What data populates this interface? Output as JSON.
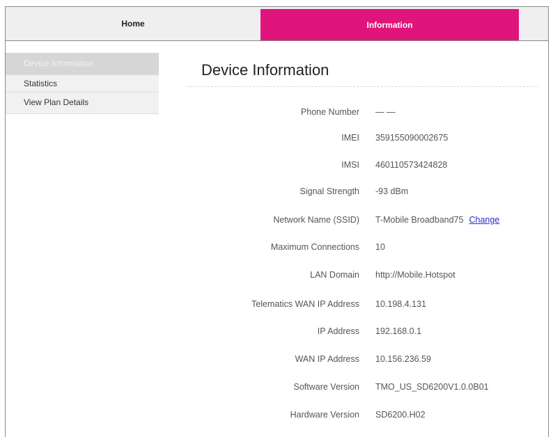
{
  "nav": {
    "home_label": "Home",
    "information_label": "Information"
  },
  "colors": {
    "accent": "#e0157b"
  },
  "sidebar": {
    "items": [
      {
        "label": "Device Information",
        "active": true
      },
      {
        "label": "Statistics",
        "active": false
      },
      {
        "label": "View Plan Details",
        "active": false
      }
    ]
  },
  "main": {
    "title": "Device Information",
    "change_link": "Change",
    "rows": [
      {
        "label": "Phone Number",
        "value": "— —"
      },
      {
        "label": "IMEI",
        "value": "359155090002675"
      },
      {
        "label": "IMSI",
        "value": "460110573424828"
      },
      {
        "label": "Signal Strength",
        "value": "-93 dBm"
      },
      {
        "label": "Network Name (SSID)",
        "value": "T-Mobile Broadband75"
      },
      {
        "label": "Maximum Connections",
        "value": "10"
      },
      {
        "label": "LAN Domain",
        "value": "http://Mobile.Hotspot"
      },
      {
        "label": "Telematics WAN IP Address",
        "value": "10.198.4.131"
      },
      {
        "label": "IP Address",
        "value": "192.168.0.1"
      },
      {
        "label": "WAN IP Address",
        "value": "10.156.236.59"
      },
      {
        "label": "Software Version",
        "value": "TMO_US_SD6200V1.0.0B01"
      },
      {
        "label": "Hardware Version",
        "value": "SD6200.H02"
      }
    ]
  }
}
